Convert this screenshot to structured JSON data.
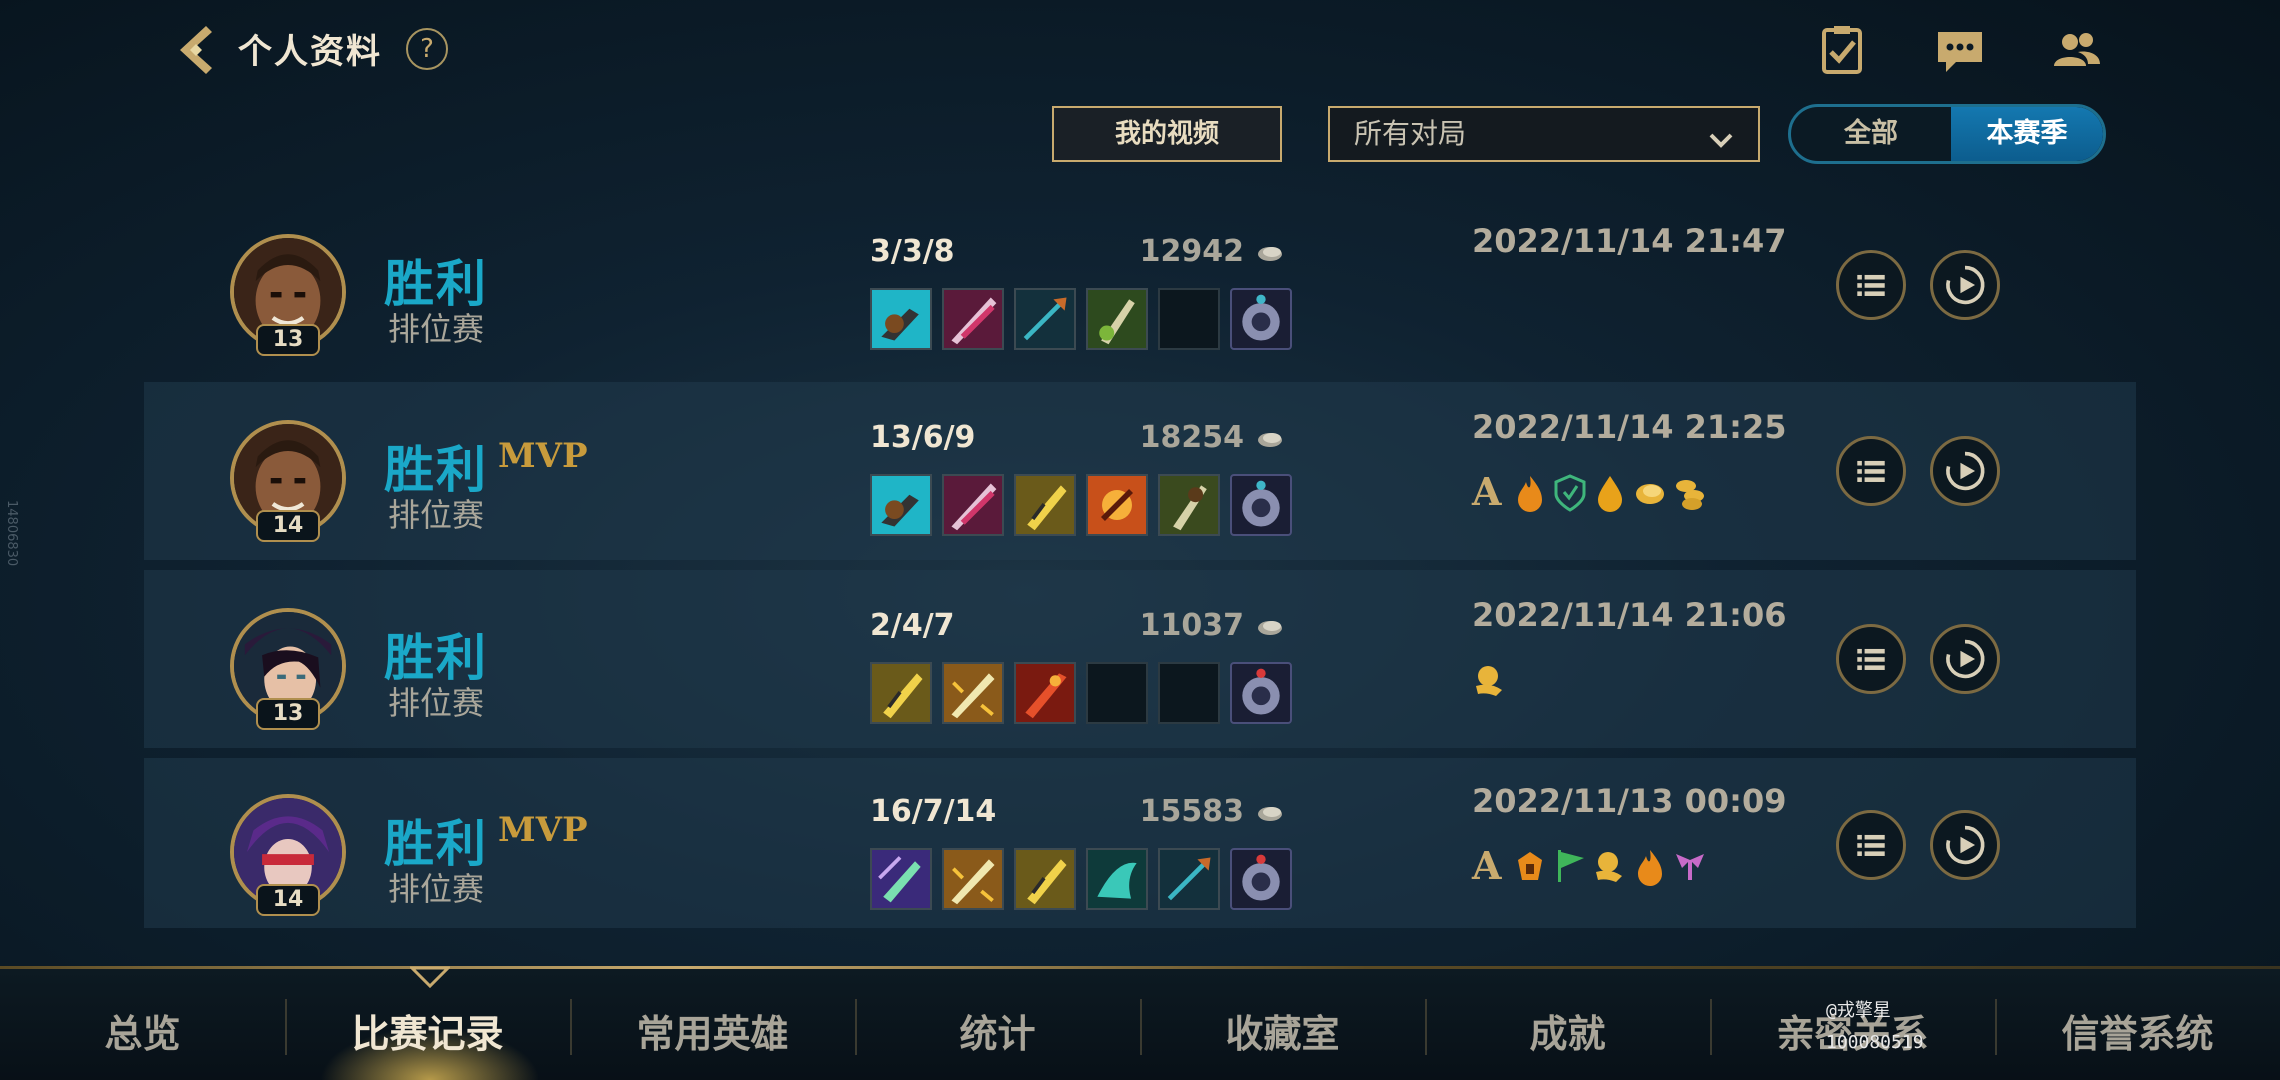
{
  "header": {
    "title": "个人资料",
    "help": "?"
  },
  "filters": {
    "my_videos": "我的视频",
    "select_value": "所有对局",
    "seg_all": "全部",
    "seg_season": "本赛季"
  },
  "matches": [
    {
      "result": "胜利",
      "mvp": "",
      "queue": "排位赛",
      "level": "13",
      "kda": "3/3/8",
      "gold": "12942",
      "datetime": "2022/11/14 21:47",
      "champion": "draven",
      "badges": []
    },
    {
      "result": "胜利",
      "mvp": "MVP",
      "queue": "排位赛",
      "level": "14",
      "kda": "13/6/9",
      "gold": "18254",
      "datetime": "2022/11/14 21:25",
      "champion": "draven",
      "badges": [
        "A",
        "fire",
        "shield",
        "drop",
        "gold",
        "coins"
      ]
    },
    {
      "result": "胜利",
      "mvp": "",
      "queue": "排位赛",
      "level": "13",
      "kda": "2/4/7",
      "gold": "11037",
      "datetime": "2022/11/14 21:06",
      "champion": "caitlyn",
      "badges": [
        "gold-hand"
      ]
    },
    {
      "result": "胜利",
      "mvp": "MVP",
      "queue": "排位赛",
      "level": "14",
      "kda": "16/7/14",
      "gold": "15583",
      "datetime": "2022/11/13 00:09",
      "champion": "vayne",
      "badges": [
        "A",
        "tower",
        "flag",
        "gold-hand",
        "fire",
        "wings"
      ]
    }
  ],
  "nav": [
    "总览",
    "比赛记录",
    "常用英雄",
    "统计",
    "收藏室",
    "成就",
    "亲密关系",
    "信誉系统"
  ],
  "watermark": {
    "line1": "@戎擎星",
    "line2": "100080519"
  },
  "side_id": "14806830",
  "colors": {
    "gold": "#c8aa6e",
    "win": "#1aa8c8",
    "mvp": "#c89b3c"
  }
}
